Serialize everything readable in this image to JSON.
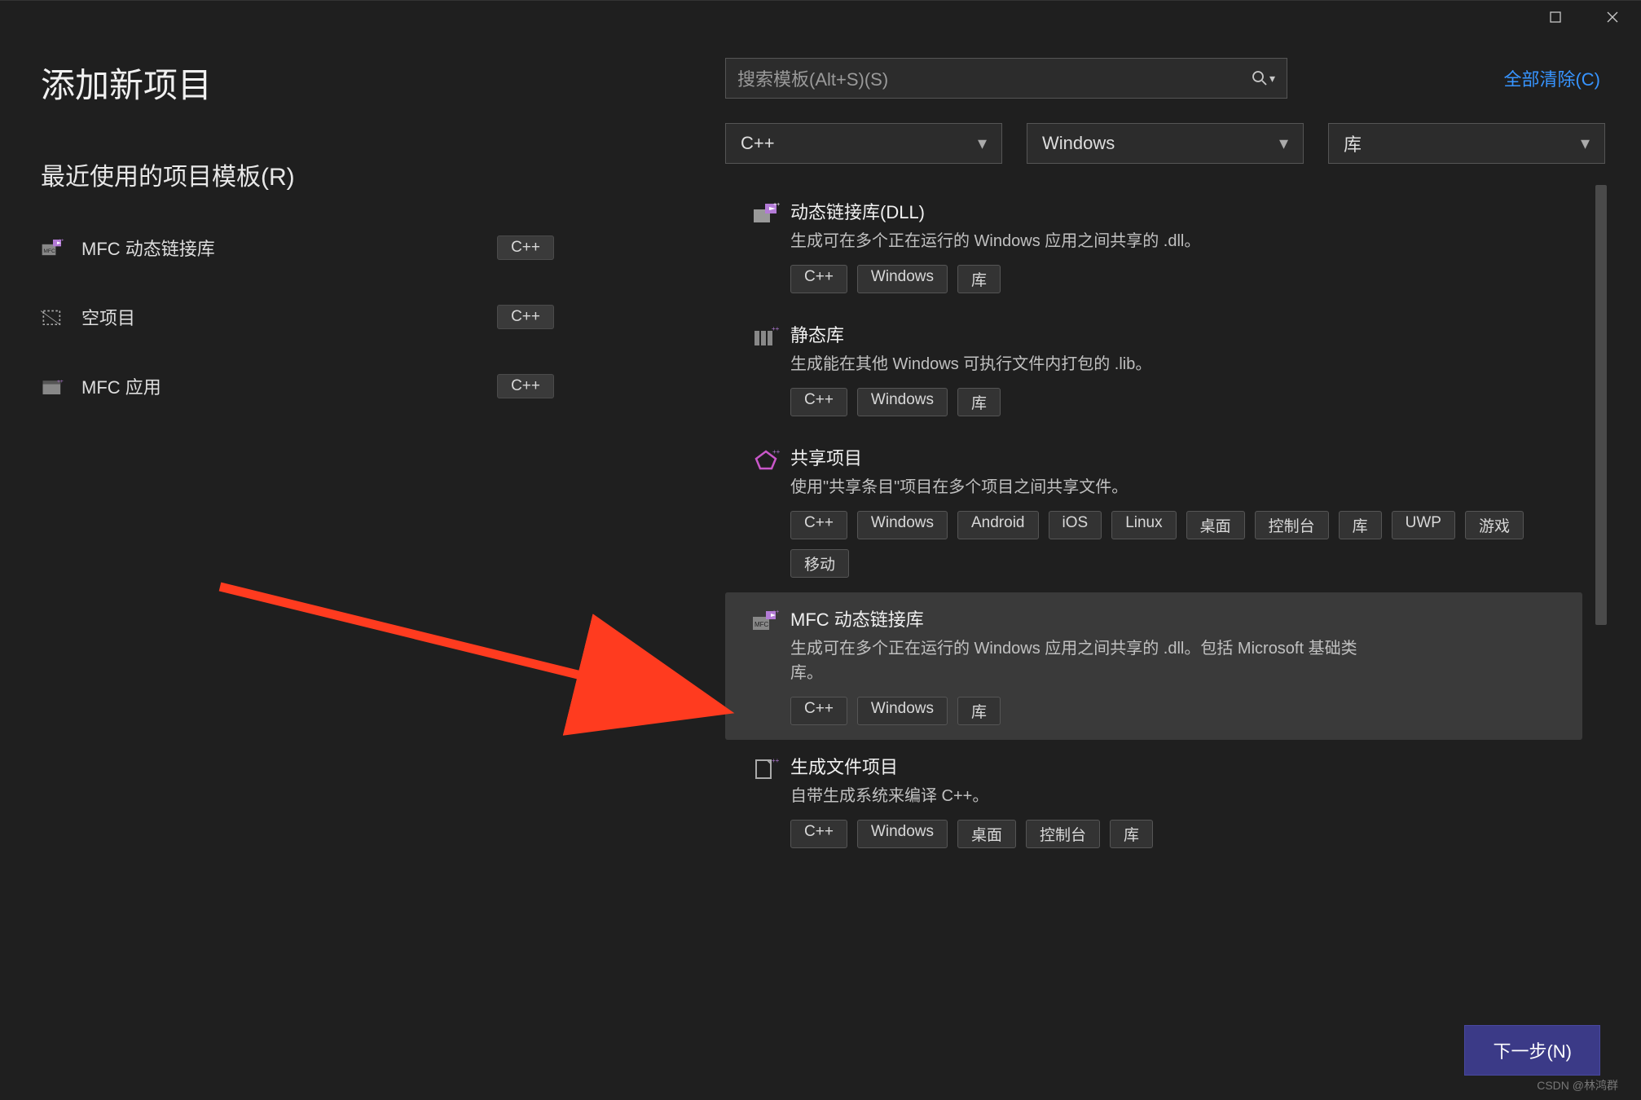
{
  "window": {
    "title": "添加新项目"
  },
  "left": {
    "section_title": "最近使用的项目模板(R)",
    "recent": [
      {
        "name": "MFC 动态链接库",
        "lang": "C++",
        "icon": "mfc-dll-icon"
      },
      {
        "name": "空项目",
        "lang": "C++",
        "icon": "empty-project-icon"
      },
      {
        "name": "MFC 应用",
        "lang": "C++",
        "icon": "mfc-app-icon"
      }
    ]
  },
  "search": {
    "placeholder": "搜索模板(Alt+S)(S)",
    "clear_label": "全部清除(C)"
  },
  "filters": {
    "language": "C++",
    "platform": "Windows",
    "project_type": "库"
  },
  "templates": [
    {
      "title": "动态链接库(DLL)",
      "desc": "生成可在多个正在运行的 Windows 应用之间共享的 .dll。",
      "tags": [
        "C++",
        "Windows",
        "库"
      ],
      "selected": false,
      "icon": "dll-icon"
    },
    {
      "title": "静态库",
      "desc": "生成能在其他 Windows 可执行文件内打包的 .lib。",
      "tags": [
        "C++",
        "Windows",
        "库"
      ],
      "selected": false,
      "icon": "lib-icon"
    },
    {
      "title": "共享项目",
      "desc": "使用\"共享条目\"项目在多个项目之间共享文件。",
      "tags": [
        "C++",
        "Windows",
        "Android",
        "iOS",
        "Linux",
        "桌面",
        "控制台",
        "库",
        "UWP",
        "游戏",
        "移动"
      ],
      "selected": false,
      "icon": "shared-icon"
    },
    {
      "title": "MFC 动态链接库",
      "desc": "生成可在多个正在运行的 Windows 应用之间共享的 .dll。包括 Microsoft 基础类库。",
      "tags": [
        "C++",
        "Windows",
        "库"
      ],
      "selected": true,
      "icon": "mfc-dll-icon"
    },
    {
      "title": "生成文件项目",
      "desc": "自带生成系统来编译 C++。",
      "tags": [
        "C++",
        "Windows",
        "桌面",
        "控制台",
        "库"
      ],
      "selected": false,
      "icon": "makefile-icon"
    }
  ],
  "footer": {
    "next": "下一步(N)"
  },
  "watermark": "CSDN @林鸿群"
}
